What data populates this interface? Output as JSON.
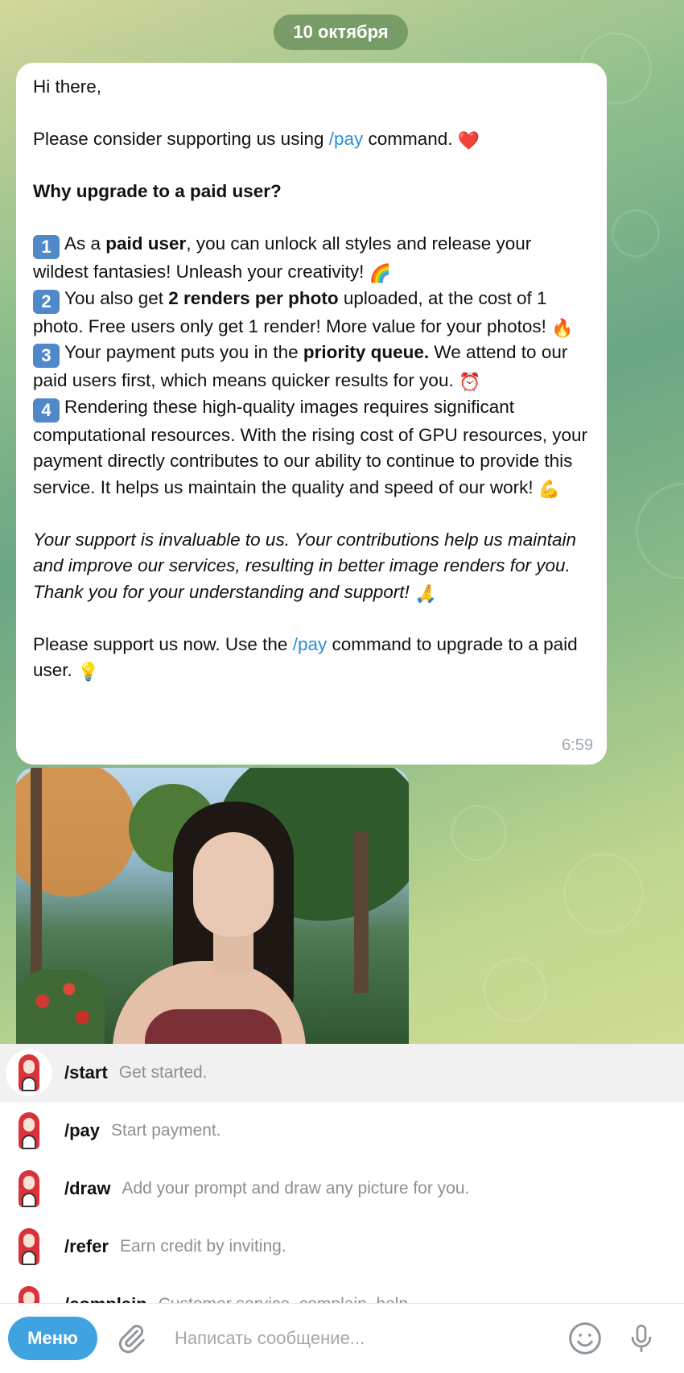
{
  "date_label": "10 октября",
  "message": {
    "greeting": "Hi there,",
    "support_pre": " Please consider supporting us using ",
    "pay_cmd": "/pay",
    "support_post": " command. ",
    "heart_emoji": "❤️",
    "why_heading": "Why upgrade to a paid user?",
    "p1_num": "1",
    "p1_a": "As a ",
    "p1_bold": "paid user",
    "p1_b": ", you can unlock all styles and release your wildest fantasies! Unleash your creativity! ",
    "p1_emoji": "🌈",
    "p2_num": "2",
    "p2_a": "You also get ",
    "p2_bold": "2 renders per photo",
    "p2_b": " uploaded, at the cost of 1 photo. Free users only get 1 render! More value for your photos! ",
    "p2_emoji": "🔥",
    "p3_num": "3",
    "p3_a": "Your payment puts you in the ",
    "p3_bold": "priority queue.",
    "p3_b": " We attend to our paid users first, which means quicker results for you. ",
    "p3_emoji": "⏰",
    "p4_num": "4",
    "p4_text": "Rendering these high-quality images requires significant computational resources. With the rising cost of GPU resources, your payment directly contributes to our ability to continue to provide this service. It helps us maintain the quality and speed of our work! ",
    "p4_emoji": "💪",
    "italic_text": "Your support is invaluable to us. Your contributions help us maintain and improve our services, resulting in better image renders for you. Thank you for your understanding and support! ",
    "italic_emoji": "🙏",
    "final_pre": "Please support us now. Use the ",
    "final_cmd": "/pay",
    "final_post": " command to upgrade to a paid user. ",
    "final_emoji": "💡",
    "time": "6:59"
  },
  "commands": [
    {
      "name": "/start",
      "desc": "Get started."
    },
    {
      "name": "/pay",
      "desc": "Start payment."
    },
    {
      "name": "/draw",
      "desc": "Add your prompt and draw any picture for you."
    },
    {
      "name": "/refer",
      "desc": "Earn credit by inviting."
    },
    {
      "name": "/complain",
      "desc": "Customer service, complain, help."
    }
  ],
  "input_bar": {
    "menu_label": "Меню",
    "placeholder": "Написать сообщение..."
  },
  "colors": {
    "link": "#2a8ed8",
    "menu_button": "#3fa2e1"
  }
}
